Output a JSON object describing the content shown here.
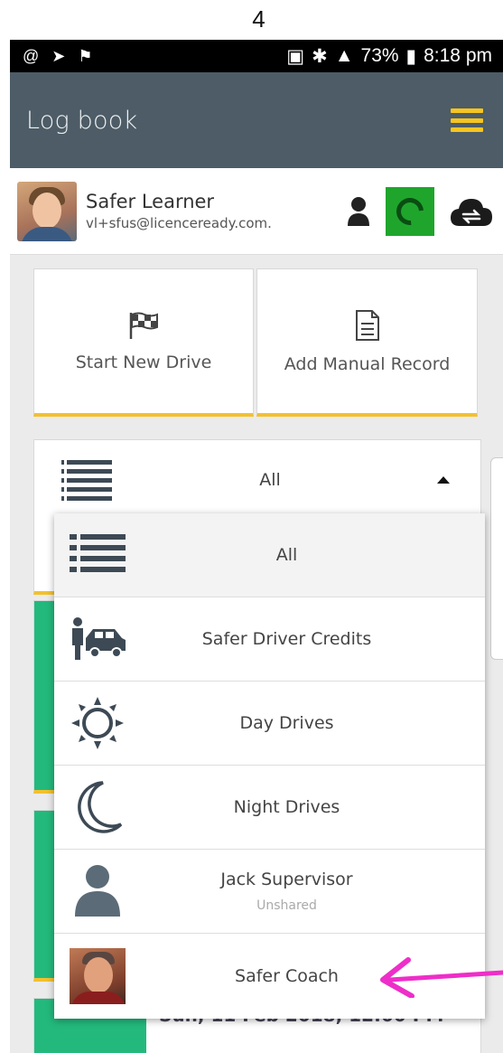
{
  "step_number": "4",
  "status_bar": {
    "battery": "73%",
    "time": "8:18 pm"
  },
  "app_bar": {
    "title": "Log book",
    "menu_icon": "hamburger-icon"
  },
  "user": {
    "name": "Safer Learner",
    "email": "vl+sfus@licenceready.com.",
    "icons": [
      "person-icon",
      "sync-status-icon",
      "cloud-sync-icon"
    ]
  },
  "actions": [
    {
      "label": "Start New Drive",
      "icon": "checkered-flag-icon"
    },
    {
      "label": "Add Manual Record",
      "icon": "document-icon"
    }
  ],
  "filter": {
    "selected": "All",
    "icon": "list-icon"
  },
  "filter_options": [
    {
      "label": "All",
      "sub": "",
      "icon": "list-icon"
    },
    {
      "label": "Safer Driver Credits",
      "sub": "",
      "icon": "driver-car-icon"
    },
    {
      "label": "Day Drives",
      "sub": "",
      "icon": "sun-icon"
    },
    {
      "label": "Night Drives",
      "sub": "",
      "icon": "moon-icon"
    },
    {
      "label": "Jack Supervisor",
      "sub": "Unshared",
      "icon": "person-icon"
    },
    {
      "label": "Safer Coach",
      "sub": "",
      "icon": "coach-photo"
    }
  ],
  "drive_card_date": "Sun, 11 Feb 2018, 12:00 PM",
  "colors": {
    "app_bar": "#4d5c66",
    "accent_yellow": "#f2c12e",
    "stripe_green": "#23b97d",
    "sync_green": "#1fa52c",
    "annotation_magenta": "#ee2ec9"
  }
}
